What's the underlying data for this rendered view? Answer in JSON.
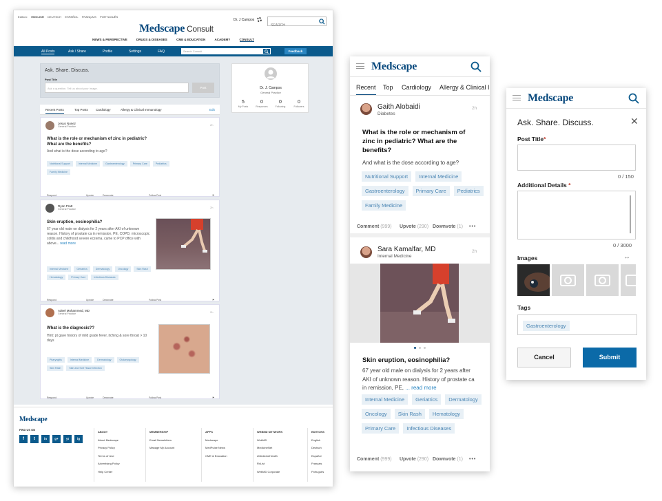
{
  "desktop": {
    "editions": {
      "label": "Edition:",
      "items": [
        "ENGLISH",
        "DEUTSCH",
        "ESPAÑOL",
        "FRANÇAIS",
        "PORTUGUÊS"
      ]
    },
    "logo": "Medscape",
    "logo_sub": "Consult",
    "user": "Dr. J Campos",
    "search_placeholder": "SEARCH",
    "nav": [
      "NEWS & PERSPECTIVE",
      "DRUGS & DISEASES",
      "CME & EDUCATION",
      "ACADEMY",
      "CONSULT"
    ],
    "subnav": [
      "All Posts",
      "Ask / Share",
      "Profile",
      "Settings",
      "FAQ"
    ],
    "search_consult": "Search Consult",
    "feedback": "Feedback",
    "ask": {
      "title": "Ask. Share. Discuss.",
      "label": "Post Title",
      "placeholder": "Ask a question. Tell us about your image.",
      "button": "Post"
    },
    "profile": {
      "name": "Dr. J. Campos",
      "specialty": "General Practice",
      "stats": [
        {
          "n": "5",
          "l": "My Posts"
        },
        {
          "n": "0",
          "l": "Responses"
        },
        {
          "n": "0",
          "l": "Following"
        },
        {
          "n": "0",
          "l": "Followers"
        }
      ]
    },
    "tabs": [
      "Recent Posts",
      "Top Posts",
      "Cardiology",
      "Allergy & Clinical Immunology"
    ],
    "edit": "Edit",
    "footer_actions": [
      "Respond",
      "Upvote",
      "Downvote",
      "Follow Post"
    ],
    "posts": [
      {
        "name": "Jesus Nunez",
        "spec": "General Practice",
        "title": "What is the role or mechanism of zinc in pediatric?\nWhat are the benefits?",
        "body": "And what is the dose according to age?",
        "tags": [
          "Nutritional Support",
          "Internal Medicine",
          "Gastroenterology",
          "Primary Care",
          "Pediatrics",
          "Family Medicine"
        ]
      },
      {
        "name": "Ryan Pratt",
        "spec": "General Practice",
        "title": "Skin eruption, eosinophilia?",
        "body": "67 year old male on dialysis for 2 years after AKI of unknown reason. History of prostate ca in remission, PE, COPD, microscopic colitis and childhood severe eczema, came to PCP office with above...",
        "readmore": "read more",
        "tags": [
          "Internal Medicine",
          "Geriatrics",
          "Dermatology",
          "Oncology",
          "Skin Rash",
          "Hematology",
          "Primary Care",
          "Infectious Diseases"
        ]
      },
      {
        "name": "Adeel Mohammed, MD",
        "spec": "General Practice",
        "title": "What is the diagnosis??",
        "body": "Hint: pt gave history of mild grade fever, itching & sore throat > 10 days",
        "tags": [
          "Pharyngitis",
          "Internal Medicine",
          "Dermatology",
          "Otolaryngology",
          "Skin Rash",
          "Skin and Soft Tissue Infection"
        ]
      }
    ],
    "footer": {
      "logo": "Medscape",
      "find_us": "FIND US ON",
      "social": [
        "f",
        "t",
        "in",
        "g+",
        "yt",
        "ig"
      ],
      "cols": [
        {
          "h": "ABOUT",
          "items": [
            "About Medscape",
            "Privacy Policy",
            "Terms of Use",
            "Advertising Policy",
            "Help Center"
          ]
        },
        {
          "h": "MEMBERSHIP",
          "items": [
            "Email Newsletters",
            "Manage My Account"
          ]
        },
        {
          "h": "APPS",
          "items": [
            "Medscape",
            "MedPulse News",
            "CME & Education"
          ]
        },
        {
          "h": "WEBMD NETWORK",
          "items": [
            "WebMD",
            "MedicineNet",
            "eMedicineHealth",
            "RxList",
            "WebMD Corporate"
          ]
        },
        {
          "h": "EDITIONS",
          "items": [
            "English",
            "Deutsch",
            "Español",
            "Français",
            "Português"
          ]
        }
      ]
    }
  },
  "mobile_feed": {
    "logo": "Medscape",
    "tabs": [
      "Recent",
      "Top",
      "Cardiology",
      "Allergy & Clinical Im"
    ],
    "post1": {
      "name": "Gaith Alobaidi",
      "sub": "Diabetes",
      "time": "2h",
      "title": "What is the role or mechanism of zinc in pediatric? What are the benefits?",
      "body": "And what is the dose according to age?",
      "tags": [
        "Nutritional Support",
        "Internal Medicine",
        "Gastroenterology",
        "Primary Care",
        "Pediatrics",
        "Family Medicine"
      ],
      "comment": "Comment",
      "comment_n": "(999)",
      "upvote": "Upvote",
      "upvote_n": "(290)",
      "downvote": "Downvote",
      "downvote_n": "(1)"
    },
    "post2": {
      "name": "Sara Kamalfar, MD",
      "sub": "Internal Medicine",
      "time": "2h",
      "title": "Skin eruption, eosinophilia?",
      "body": "67 year old male on dialysis for 2 years after AKI of unknown reason. History of prostate ca in remission, PE,",
      "readmore": "... read more",
      "tags": [
        "Internal Medicine",
        "Geriatrics",
        "Dermatology",
        "Oncology",
        "Skin Rash",
        "Hematology",
        "Primary Care",
        "Infectious Diseases"
      ],
      "comment": "Comment",
      "comment_n": "(999)",
      "upvote": "Upvote",
      "upvote_n": "(290)",
      "downvote": "Downvote",
      "downvote_n": "(1)"
    }
  },
  "mobile_form": {
    "logo": "Medscape",
    "title": "Ask. Share. Discuss.",
    "post_title": "Post Title",
    "post_count": "0 / 150",
    "details": "Additional Details",
    "details_count": "0 / 3000",
    "images": "Images",
    "tags": "Tags",
    "tag": "Gastroenterology",
    "cancel": "Cancel",
    "submit": "Submit"
  },
  "colors": {
    "brand": "#0a4a7e",
    "nav": "#0b5a8c",
    "tag_bg": "#e3edf5",
    "tag_text": "#4a85b3",
    "submit": "#0b6aa8"
  }
}
